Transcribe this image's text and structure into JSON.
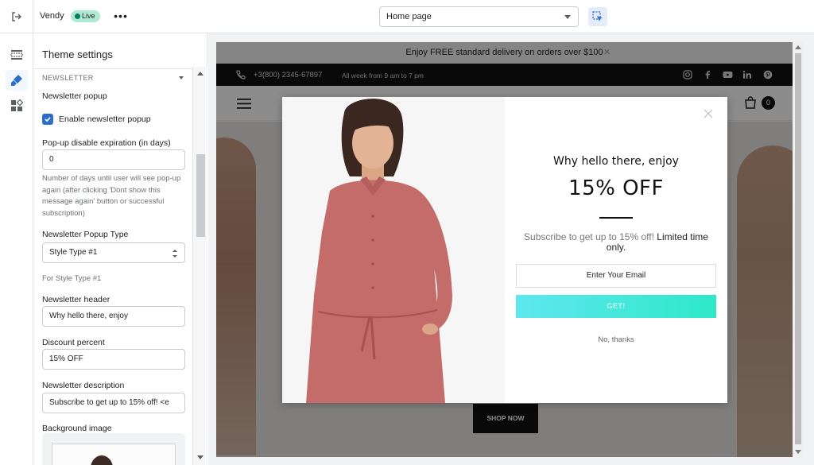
{
  "topbar": {
    "store_name": "Vendy",
    "status_badge": "Live",
    "page_selector_value": "Home page"
  },
  "panel": {
    "title": "Theme settings",
    "section_label": "NEWSLETTER",
    "newsletter_popup_heading": "Newsletter popup",
    "enable_popup_label": "Enable newsletter popup",
    "enable_popup_checked": true,
    "expiration_label": "Pop-up disable expiration (in days)",
    "expiration_value": "0",
    "expiration_help": "Number of days until user will see pop-up again (after clicking 'Dont show this message again' button or successful subscription)",
    "popup_type_label": "Newsletter Popup Type",
    "popup_type_value": "Style Type #1",
    "style_type_note": "For Style Type #1",
    "header_label": "Newsletter header",
    "header_value": "Why hello there, enjoy",
    "discount_label": "Discount percent",
    "discount_value": "15% OFF",
    "description_label": "Newsletter description",
    "description_value": "Subscribe to get up to 15% off! <e",
    "bg_image_label": "Background image"
  },
  "preview": {
    "announcement": "Enjoy FREE standard delivery on orders over $100",
    "phone": "+3(800) 2345-67897",
    "hours": "All week from 9 am to 7 pm",
    "cart_count": "0",
    "shop_now": "SHOP NOW",
    "modal": {
      "header": "Why hello there, enjoy",
      "discount": "15% OFF",
      "description_muted": "Subscribe to get up to 15% off!",
      "description_dark": "Limited time only.",
      "email_placeholder": "Enter Your Email",
      "submit_label": "GET!",
      "decline_label": "No, thanks"
    }
  },
  "colors": {
    "accent_blue": "#2c6ecb",
    "live_badge_bg": "#aee9d1",
    "submit_gradient_start": "#5ee7ef",
    "submit_gradient_end": "#2ee8c8"
  }
}
